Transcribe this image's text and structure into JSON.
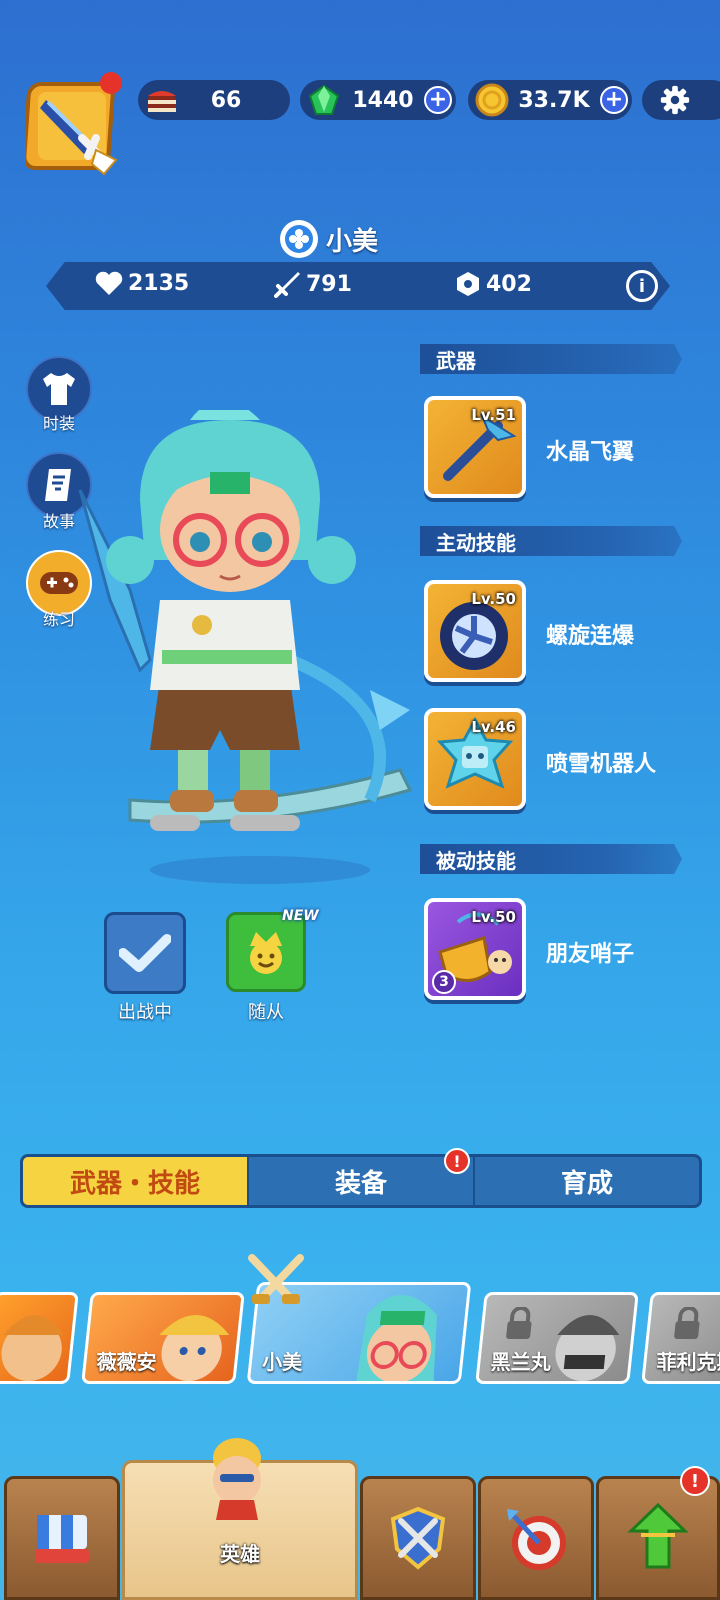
{
  "resources": {
    "cake": "66",
    "gems": "1440",
    "coins": "33.7K"
  },
  "hero": {
    "name": "小美",
    "hp": "2135",
    "attack": "791",
    "defense": "402"
  },
  "side_menu": {
    "costume": "时装",
    "story": "故事",
    "practice": "练习"
  },
  "sections": {
    "weapon": "武器",
    "active_skills": "主动技能",
    "passive_skills": "被动技能"
  },
  "weapon": {
    "level": "Lv.51",
    "name": "水晶飞翼"
  },
  "active_skills": [
    {
      "level": "Lv.50",
      "name": "螺旋连爆"
    },
    {
      "level": "Lv.46",
      "name": "喷雪机器人"
    }
  ],
  "passive_skills": [
    {
      "level": "Lv.50",
      "name": "朋友哨子",
      "rank": "3"
    }
  ],
  "actions": {
    "deployed": "出战中",
    "follower": "随从",
    "new_badge": "NEW"
  },
  "tabs": [
    "武器・技能",
    "装备",
    "育成"
  ],
  "heroes": [
    "薇薇安",
    "小美",
    "黑兰丸",
    "菲利克斯"
  ],
  "bottom_nav": {
    "hero": "英雄"
  },
  "colors": {
    "accent_yellow": "#f6d341",
    "alert_red": "#e5332a",
    "panel_blue": "#1d3f7e"
  }
}
